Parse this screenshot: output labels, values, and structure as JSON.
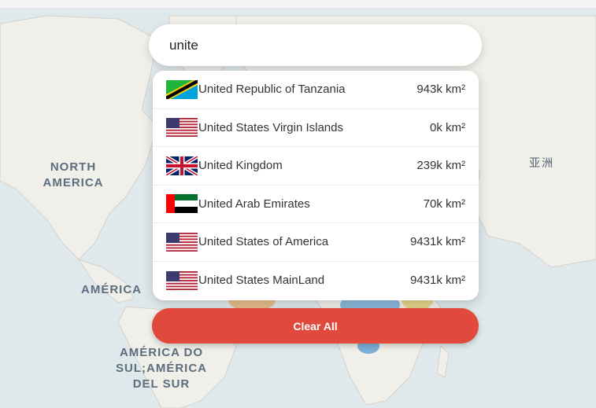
{
  "search": {
    "value": "unite"
  },
  "results": [
    {
      "name": "United Republic of Tanzania",
      "area": "943k km²",
      "flag": "tanzania-flag"
    },
    {
      "name": "United States Virgin Islands",
      "area": "0k km²",
      "flag": "usa-flag"
    },
    {
      "name": "United Kingdom",
      "area": "239k km²",
      "flag": "uk-flag"
    },
    {
      "name": "United Arab Emirates",
      "area": "70k km²",
      "flag": "uae-flag"
    },
    {
      "name": "United States of America",
      "area": "9431k km²",
      "flag": "usa-flag"
    },
    {
      "name": "United States MainLand",
      "area": "9431k km²",
      "flag": "usa-flag"
    }
  ],
  "clear_button": {
    "label": "Clear All"
  },
  "map_labels": {
    "north_america": "NORTH AMERICA",
    "america": "AMÉRICA",
    "south_america": "AMÉRICA DO SUL;AMÉRICA DEL SUR",
    "asia": "亚洲"
  }
}
